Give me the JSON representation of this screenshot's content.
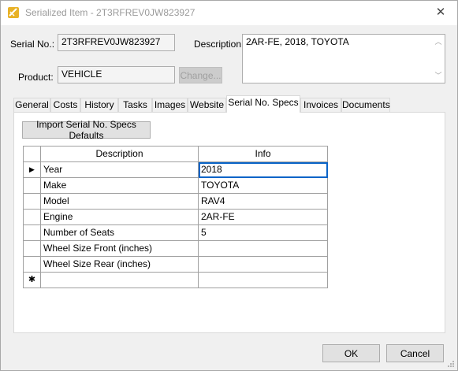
{
  "window": {
    "title": "Serialized Item - 2T3RFREV0JW823927",
    "close_glyph": "✕"
  },
  "form": {
    "serial_label": "Serial No.:",
    "serial_value": "2T3RFREV0JW823927",
    "description_label": "Description:",
    "description_value": "2AR-FE, 2018, TOYOTA",
    "product_label": "Product:",
    "product_value": "VEHICLE",
    "change_button": "Change..."
  },
  "tabs": [
    {
      "label": "General"
    },
    {
      "label": "Costs"
    },
    {
      "label": "History"
    },
    {
      "label": "Tasks"
    },
    {
      "label": "Images"
    },
    {
      "label": "Website"
    },
    {
      "label": "Serial No. Specs",
      "active": true
    },
    {
      "label": "Invoices"
    },
    {
      "label": "Documents"
    }
  ],
  "specs": {
    "import_button": "Import Serial No. Specs Defaults",
    "columns": [
      "Description",
      "Info"
    ],
    "rows": [
      {
        "description": "Year",
        "info": "2018"
      },
      {
        "description": "Make",
        "info": "TOYOTA"
      },
      {
        "description": "Model",
        "info": "RAV4"
      },
      {
        "description": "Engine",
        "info": "2AR-FE"
      },
      {
        "description": "Number of Seats",
        "info": "5"
      },
      {
        "description": "Wheel Size Front (inches)",
        "info": ""
      },
      {
        "description": "Wheel Size Rear (inches)",
        "info": ""
      }
    ],
    "current_row_glyph": "▶",
    "new_row_glyph": "✱"
  },
  "footer": {
    "ok_label": "OK",
    "cancel_label": "Cancel"
  },
  "colors": {
    "selection_border": "#0a64c8",
    "app_icon": "#e8b227"
  }
}
